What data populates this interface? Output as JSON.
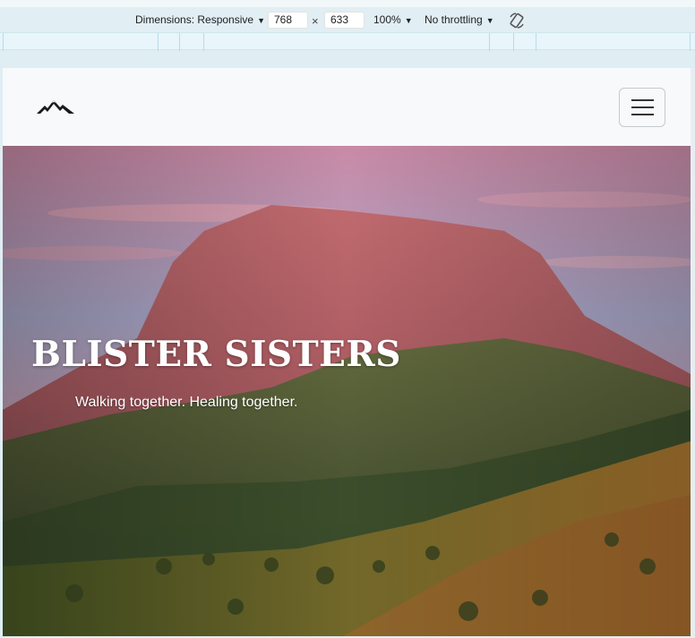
{
  "devtools": {
    "dimensions_label": "Dimensions: Responsive",
    "width_value": "768",
    "height_value": "633",
    "times": "×",
    "zoom_label": "100%",
    "throttle_label": "No throttling",
    "caret": "▼",
    "rotate_icon": "rotate-icon"
  },
  "site": {
    "logo_icon": "mountain-logo-icon",
    "menu_icon": "hamburger-menu-icon",
    "hero": {
      "title": "BLISTER SISTERS",
      "subtitle": "Walking together. Healing together."
    }
  },
  "colors": {
    "navbar_bg": "#f8f9fa",
    "hero_text": "#ffffff",
    "devtools_bg": "#e1eef3"
  }
}
